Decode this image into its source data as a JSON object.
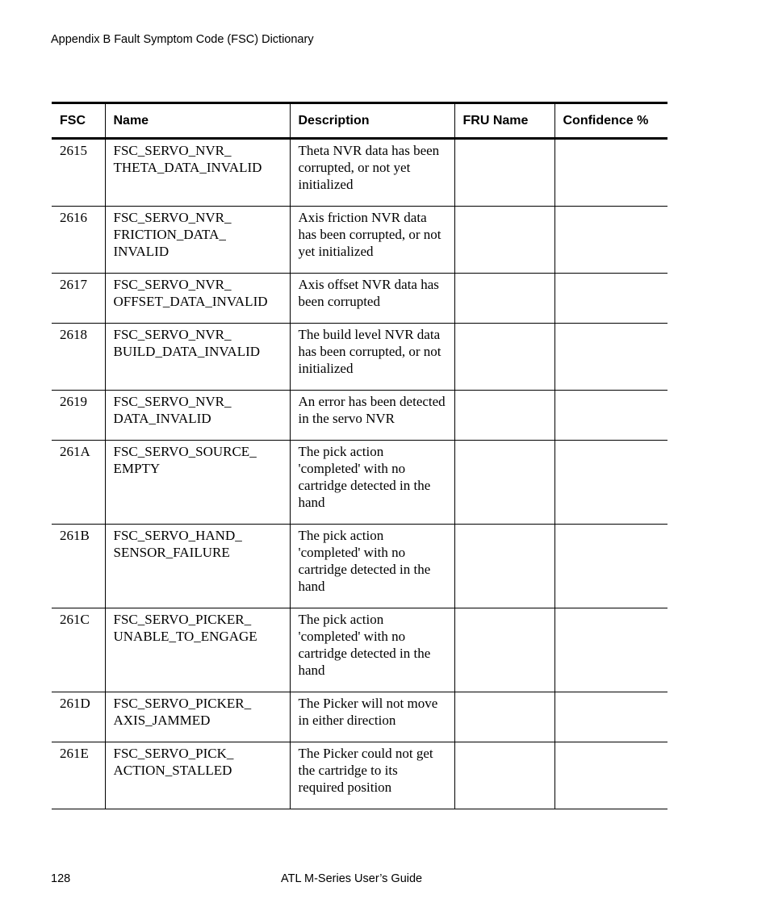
{
  "page": {
    "header": "Appendix B  Fault Symptom Code (FSC) Dictionary",
    "footer_page_number": "128",
    "footer_title": "ATL M-Series User’s Guide"
  },
  "table": {
    "columns": [
      "FSC",
      "Name",
      "Description",
      "FRU Name",
      "Confidence %"
    ],
    "rows": [
      {
        "fsc": "2615",
        "name_lines": [
          "FSC_SERVO_NVR_",
          "THETA_DATA_INVALID"
        ],
        "description": "Theta NVR data has been corrupted, or not yet initialized",
        "fru_name": "",
        "confidence": ""
      },
      {
        "fsc": "2616",
        "name_lines": [
          "FSC_SERVO_NVR_",
          "FRICTION_DATA_",
          "INVALID"
        ],
        "description": "Axis friction NVR data has been corrupted, or not yet initialized",
        "fru_name": "",
        "confidence": ""
      },
      {
        "fsc": "2617",
        "name_lines": [
          "FSC_SERVO_NVR_",
          "OFFSET_DATA_INVALID"
        ],
        "description": "Axis offset NVR data has been corrupted",
        "fru_name": "",
        "confidence": ""
      },
      {
        "fsc": "2618",
        "name_lines": [
          "FSC_SERVO_NVR_",
          "BUILD_DATA_INVALID"
        ],
        "description": "The build level NVR data has been corrupted, or not initialized",
        "fru_name": "",
        "confidence": ""
      },
      {
        "fsc": "2619",
        "name_lines": [
          "FSC_SERVO_NVR_",
          "DATA_INVALID"
        ],
        "description": "An error has been detected in the servo NVR",
        "fru_name": "",
        "confidence": ""
      },
      {
        "fsc": "261A",
        "name_lines": [
          "FSC_SERVO_SOURCE_",
          "EMPTY"
        ],
        "description": "The pick action 'completed' with no cartridge detected in the hand",
        "fru_name": "",
        "confidence": ""
      },
      {
        "fsc": "261B",
        "name_lines": [
          "FSC_SERVO_HAND_",
          "SENSOR_FAILURE"
        ],
        "description": "The pick action 'completed' with no cartridge detected in the hand",
        "fru_name": "",
        "confidence": ""
      },
      {
        "fsc": "261C",
        "name_lines": [
          "FSC_SERVO_PICKER_",
          "UNABLE_TO_ENGAGE"
        ],
        "description": "The pick action 'completed' with no cartridge detected in the hand",
        "fru_name": "",
        "confidence": ""
      },
      {
        "fsc": "261D",
        "name_lines": [
          "FSC_SERVO_PICKER_",
          "AXIS_JAMMED"
        ],
        "description": "The Picker will not move in either direction",
        "fru_name": "",
        "confidence": ""
      },
      {
        "fsc": "261E",
        "name_lines": [
          "FSC_SERVO_PICK_",
          "ACTION_STALLED"
        ],
        "description": "The Picker could not get the cartridge to its required position",
        "fru_name": "",
        "confidence": ""
      }
    ]
  }
}
